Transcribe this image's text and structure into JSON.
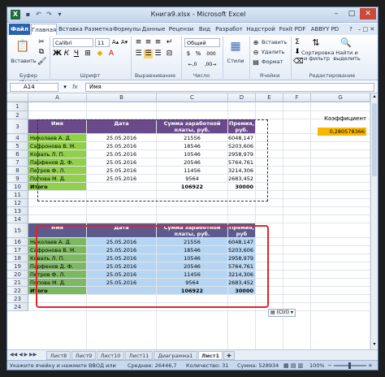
{
  "window": {
    "title": "Книга9.xlsx - Microsoft Excel"
  },
  "ribbon_tabs": [
    "Файл",
    "Главная",
    "Вставка",
    "Разметка",
    "Формулы",
    "Данные",
    "Рецензи",
    "Вид",
    "Разработ",
    "Надстрой",
    "Foxit PDF",
    "ABBYY PD"
  ],
  "ribbon": {
    "paste": "Вставить",
    "clipboard": "Буфер обмена",
    "font_name": "Calibri",
    "font_size": "11",
    "font_group": "Шрифт",
    "align_group": "Выравнивание",
    "number_format": "Общий",
    "number_group": "Число",
    "styles": "Стили",
    "insert": "Вставить",
    "delete": "Удалить",
    "format": "Формат",
    "cells_group": "Ячейки",
    "sort_filter": "Сортировка и фильтр",
    "find_select": "Найти и выделить",
    "editing_group": "Редактирование",
    "bold": "Ж",
    "italic": "К",
    "underline": "Ч",
    "percent": "%",
    "thousands": "000"
  },
  "formula_bar": {
    "name_box": "A14",
    "fx": "fx",
    "value": "Имя"
  },
  "columns": [
    "A",
    "B",
    "C",
    "D",
    "E",
    "F",
    "G"
  ],
  "rows": [
    "1",
    "2",
    "3",
    "4",
    "5",
    "6",
    "7",
    "8",
    "9",
    "10",
    "11",
    "12",
    "13",
    "14",
    "15",
    "16",
    "17",
    "18",
    "19",
    "20",
    "21",
    "22",
    "23",
    "24"
  ],
  "coef": {
    "label": "Коэффициент",
    "value": "0,280578366"
  },
  "table1": {
    "header": [
      "Имя",
      "Дата",
      "Сумма заработной платы, руб.",
      "Премия, руб."
    ],
    "rows": [
      [
        "Николаев А. Д.",
        "25.05.2016",
        "21556",
        "6048,147"
      ],
      [
        "Сафронова В. М.",
        "25.05.2016",
        "18546",
        "5203,606"
      ],
      [
        "Коваль Л. П.",
        "25.05.2016",
        "10546",
        "2958,979"
      ],
      [
        "Парфенов Д. Ф.",
        "25.05.2016",
        "20546",
        "5764,761"
      ],
      [
        "Петров Ф. Л.",
        "25.05.2016",
        "11456",
        "3214,306"
      ],
      [
        "Попова М. Д.",
        "25.05.2016",
        "9564",
        "2683,452"
      ]
    ],
    "total": [
      "Итого",
      "",
      "106922",
      "30000"
    ]
  },
  "table2": {
    "header": [
      "Имя",
      "Дата",
      "Сумма заработной платы, руб.",
      "Премия, руб"
    ],
    "rows": [
      [
        "Николаев А. Д.",
        "25.05.2016",
        "21556",
        "6048,147"
      ],
      [
        "Сафронова В. М.",
        "25.05.2016",
        "18546",
        "5203,606"
      ],
      [
        "Коваль Л. П.",
        "25.05.2016",
        "10546",
        "2958,979"
      ],
      [
        "Парфенов Д. Ф.",
        "25.05.2016",
        "20546",
        "5764,761"
      ],
      [
        "Петров Ф. Л.",
        "25.05.2016",
        "11456",
        "3214,306"
      ],
      [
        "Попова М. Д.",
        "25.05.2016",
        "9564",
        "2683,452"
      ]
    ],
    "total": [
      "Итого",
      "",
      "106922",
      "30000"
    ]
  },
  "paste_options": "(Ctrl)",
  "sheet_tabs": [
    "Лист8",
    "Лист9",
    "Лист10",
    "Лист11",
    "Диаграмма1",
    "Лист1"
  ],
  "status": {
    "hint": "Укажите ячейку и нажмите ВВОД или",
    "average": "Среднее: 26446,7",
    "count": "Количество: 31",
    "sum": "Сумма: 528934",
    "zoom": "100%"
  },
  "colors": {
    "header_purple": "#6a4a8b",
    "name_green": "#92cf4a",
    "selection_blue": "#b6d5f2",
    "coef_orange": "#f9b800",
    "selection_border": "#e0242a"
  }
}
